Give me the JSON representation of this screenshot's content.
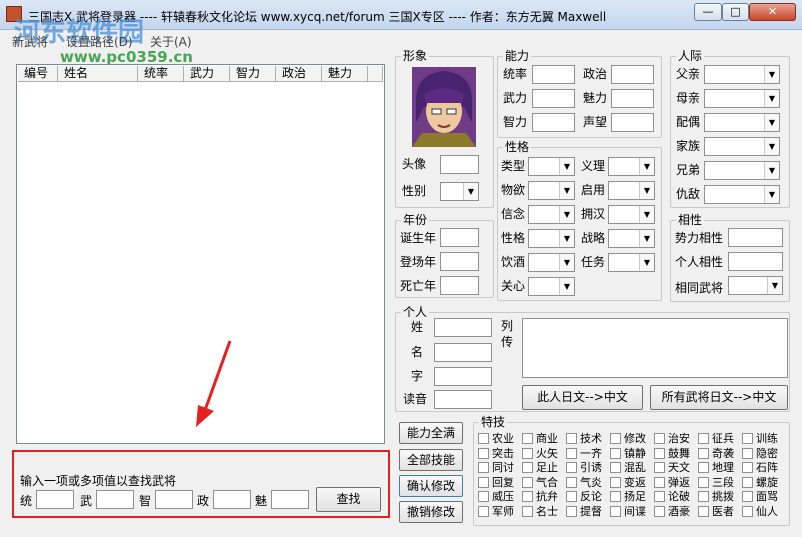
{
  "window": {
    "title": "三国志X 武将登录器 ---- 轩辕春秋文化论坛 www.xycq.net/forum 三国X专区 ---- 作者：东方无翼 Maxwell"
  },
  "menu": [
    "新武将",
    "设置路径(D)",
    "关于(A)"
  ],
  "watermark": {
    "line1": "河东软件园",
    "line2": "www.pc0359.cn"
  },
  "list": {
    "columns": [
      "编号",
      "姓名",
      "统率",
      "武力",
      "智力",
      "政治",
      "魅力"
    ]
  },
  "search": {
    "title": "输入一项或多项值以查找武将",
    "fields": [
      "统",
      "武",
      "智",
      "政",
      "魅"
    ],
    "button": "查找"
  },
  "portrait": {
    "title": "形象",
    "fields": [
      "头像",
      "性别"
    ]
  },
  "ability": {
    "title": "能力",
    "left": [
      "统率",
      "武力",
      "智力"
    ],
    "right": [
      "政治",
      "魅力",
      "声望"
    ]
  },
  "relations": {
    "title": "人际",
    "fields": [
      "父亲",
      "母亲",
      "配偶",
      "家族",
      "兄弟",
      "仇敌"
    ]
  },
  "year": {
    "title": "年份",
    "fields": [
      "诞生年",
      "登场年",
      "死亡年"
    ]
  },
  "personality": {
    "title": "性格",
    "left": [
      "类型",
      "物欲",
      "信念",
      "性格",
      "饮酒",
      "关心"
    ],
    "right": [
      "义理",
      "启用",
      "拥汉",
      "战略",
      "任务"
    ]
  },
  "affinity": {
    "title": "相性",
    "fields": [
      "势力相性",
      "个人相性",
      "相同武将"
    ]
  },
  "personal": {
    "title": "个人",
    "fields": [
      "姓",
      "名",
      "字",
      "读音"
    ],
    "bio_label": "列传",
    "btn_one": "此人日文-->中文",
    "btn_all": "所有武将日文-->中文"
  },
  "actions": [
    "能力全满",
    "全部技能",
    "确认修改",
    "撤销修改"
  ],
  "skills": {
    "title": "特技",
    "rows": [
      [
        "农业",
        "商业",
        "技术",
        "修改",
        "治安",
        "征兵",
        "训练"
      ],
      [
        "突击",
        "火矢",
        "一齐",
        "镇静",
        "鼓舞",
        "奇袭",
        "隐密"
      ],
      [
        "同讨",
        "足止",
        "引诱",
        "混乱",
        "天文",
        "地理",
        "石阵"
      ],
      [
        "回复",
        "气合",
        "气炎",
        "变返",
        "弹返",
        "三段",
        "螺旋"
      ],
      [
        "威压",
        "抗弁",
        "反论",
        "扬足",
        "论破",
        "挑拨",
        "面骂"
      ],
      [
        "军师",
        "名士",
        "提督",
        "间谍",
        "酒豪",
        "医者",
        "仙人"
      ]
    ]
  }
}
